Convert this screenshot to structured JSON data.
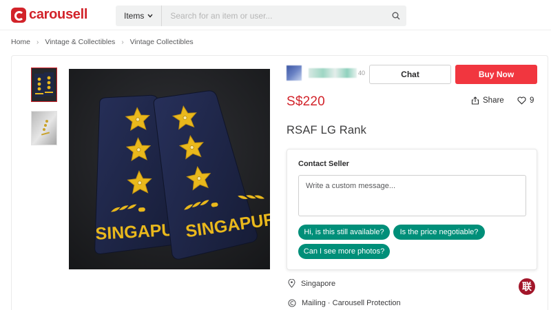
{
  "header": {
    "logo_text": "carousell",
    "search": {
      "category": "Items",
      "placeholder": "Search for an item or user..."
    }
  },
  "breadcrumb": [
    "Home",
    "Vintage & Collectibles",
    "Vintage Collectibles"
  ],
  "listing": {
    "seller": {
      "review_count": "40"
    },
    "chat_label": "Chat",
    "buy_label": "Buy Now",
    "price": "S$220",
    "share_label": "Share",
    "likes": "9",
    "title": "RSAF LG Rank",
    "photo_text": "SINGAPURA",
    "contact": {
      "title": "Contact Seller",
      "placeholder": "Write a custom message...",
      "quick_replies": [
        "Hi, is this still available?",
        "Is the price negotiable?",
        "Can I see more photos?"
      ]
    },
    "location": "Singapore",
    "delivery": "Mailing · Carousell Protection"
  },
  "watermark_text": "联",
  "colors": {
    "brand_red": "#d2232a",
    "buy_button": "#f1363f",
    "chip_green": "#008f79",
    "rank_gold": "#e9b81c",
    "cloth_navy": "#1f2746"
  },
  "icons": [
    "search-icon",
    "chevron-down-icon",
    "chevron-right-icon",
    "share-icon",
    "heart-icon",
    "location-pin-icon",
    "protection-icon"
  ]
}
